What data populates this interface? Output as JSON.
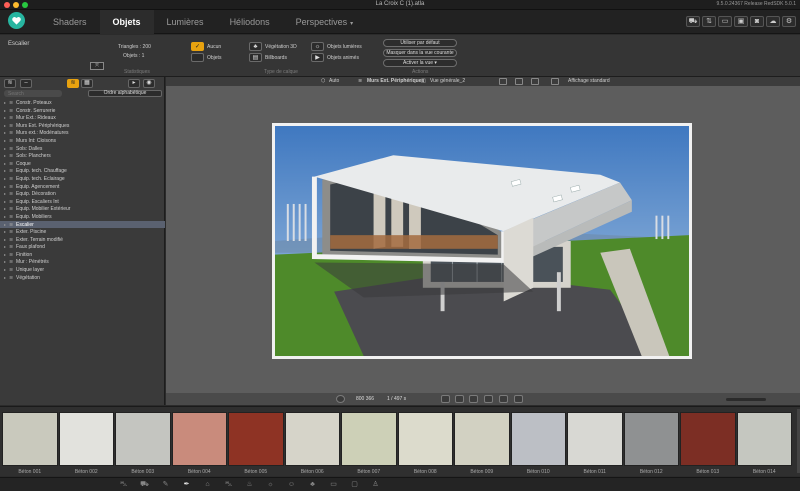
{
  "window": {
    "title": "La Croix C (1).atla",
    "version": "9.5.0.24367 Release RedSDK 5.0.1",
    "traffic_colors": [
      "#ff5f57",
      "#febc2e",
      "#28c840"
    ]
  },
  "nav": {
    "logo_icon": "heart-logo-icon",
    "tabs": [
      {
        "label": "Shaders"
      },
      {
        "label": "Objets"
      },
      {
        "label": "Lumières"
      },
      {
        "label": "Héliodons"
      },
      {
        "label": "Perspectives"
      }
    ],
    "perspectives_caret": "▾",
    "right_icons": [
      "cart-icon",
      "sync-icon",
      "document-icon",
      "window-icon",
      "camera-icon",
      "cloud-icon",
      "gear-icon"
    ]
  },
  "toolbar": {
    "object_name": "Escalier",
    "triangles": "Triangles : 200",
    "objects": "Objets : 1",
    "section_stats": "Statistiques",
    "section_layer_type": "Type de calque",
    "section_actions": "Actions",
    "type_aucun": "Aucun",
    "type_objets": "Objets",
    "type_vegetation": "Végétation 3D",
    "type_billboards": "Billboards",
    "type_objets_lumieres": "Objets lumières",
    "type_objets_animes": "Objets animés",
    "btn_default": "Utiliser par défaut",
    "btn_hide": "Masquer dans la vue courante",
    "btn_activate": "Activer la vue",
    "accent_color": "#e8a20f"
  },
  "left_panel": {
    "search_placeholder": "Search",
    "sort_label": "Ordre alphabétique",
    "selected_index": 17,
    "layers": [
      {
        "name": "Constr. Poteaux",
        "arrow": "▸"
      },
      {
        "name": "Constr. Serrurerie",
        "arrow": "▸"
      },
      {
        "name": "Mur Ext.: Rideaux",
        "arrow": "▸"
      },
      {
        "name": "Murs Ext. Périphériques",
        "arrow": "▸"
      },
      {
        "name": "Murs ext.: Modénatures",
        "arrow": "▸"
      },
      {
        "name": "Murs Int: Cloisons",
        "arrow": "▸"
      },
      {
        "name": "Sols: Dalles",
        "arrow": "▸"
      },
      {
        "name": "Sols: Planchers",
        "arrow": "▸"
      },
      {
        "name": "Coque",
        "arrow": "▸"
      },
      {
        "name": "Equip. tech. Chauffage",
        "arrow": "▸"
      },
      {
        "name": "Equip. tech. Eclairage",
        "arrow": "▸"
      },
      {
        "name": "Equip. Agencement",
        "arrow": "▸"
      },
      {
        "name": "Equip. Décoration",
        "arrow": "▸"
      },
      {
        "name": "Equip. Escaliers Int",
        "arrow": "▸"
      },
      {
        "name": "Equip. Mobilier Extérieur",
        "arrow": "▸"
      },
      {
        "name": "Equip. Mobiliers",
        "arrow": "▸"
      },
      {
        "name": "Escalier",
        "arrow": "▸"
      },
      {
        "name": "Exter. Piscine",
        "arrow": "▸"
      },
      {
        "name": "Exter. Terrain modifié",
        "arrow": "▸"
      },
      {
        "name": "Faux plafond",
        "arrow": "▸"
      },
      {
        "name": "Finition",
        "arrow": "▸"
      },
      {
        "name": "Mur : Pénétrés",
        "arrow": "▸"
      },
      {
        "name": "Unique layer",
        "arrow": "▸"
      },
      {
        "name": "Végétation",
        "arrow": "▸"
      }
    ]
  },
  "viewport": {
    "auto_label": "Auto",
    "active_layer": "Murs Ext. Périphériques",
    "view_name": "Vue générale_2",
    "display_mode": "Affichage standard",
    "resolution": "800 366",
    "frame_info": "1 / 497 s",
    "sky_top": "#3f78c0",
    "sky_bottom": "#a9c6e4",
    "grass_color": "#4e8a2a",
    "asphalt_color": "#4b4b4f"
  },
  "materials": [
    {
      "name": "Béton 001",
      "color": "#c9c9bd"
    },
    {
      "name": "Béton 002",
      "color": "#e2e2dd"
    },
    {
      "name": "Béton 003",
      "color": "#c4c5c0"
    },
    {
      "name": "Béton 004",
      "color": "#c98b7c"
    },
    {
      "name": "Béton 005",
      "color": "#8e3324"
    },
    {
      "name": "Béton 006",
      "color": "#d6d4c9"
    },
    {
      "name": "Béton 007",
      "color": "#cdd0b7"
    },
    {
      "name": "Béton 008",
      "color": "#dcdbcc"
    },
    {
      "name": "Béton 009",
      "color": "#d2d1c2"
    },
    {
      "name": "Béton 010",
      "color": "#bcbfc5"
    },
    {
      "name": "Béton 011",
      "color": "#d8d8d3"
    },
    {
      "name": "Béton 012",
      "color": "#8f9192"
    },
    {
      "name": "Béton 013",
      "color": "#7c2e24"
    },
    {
      "name": "Béton 014",
      "color": "#c5c7c0"
    }
  ],
  "statusbar": {
    "icons": [
      "car-icon",
      "bus-icon",
      "brush-icon",
      "pen-icon",
      "building-icon",
      "car-front-icon",
      "lamp-icon",
      "light-icon",
      "person-icon",
      "tree-icon",
      "sofa-icon",
      "folder-icon",
      "person-walk-icon"
    ]
  }
}
